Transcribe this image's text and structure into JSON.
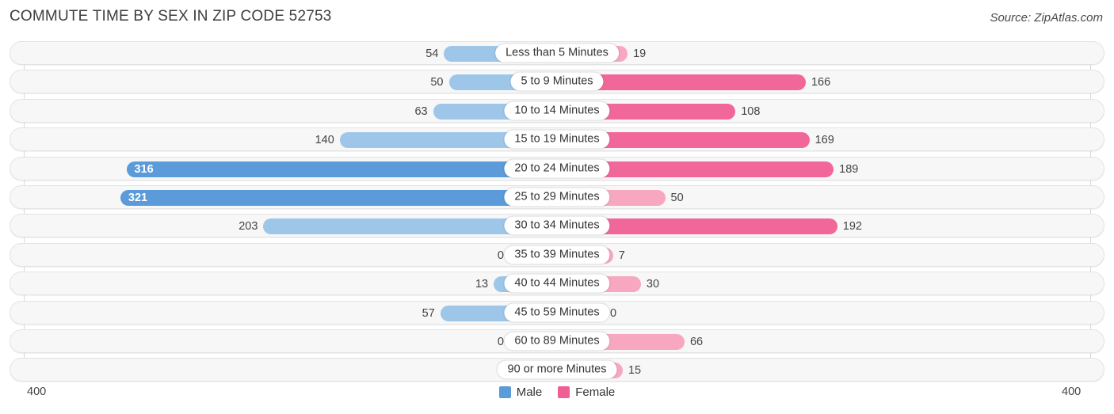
{
  "header": {
    "title": "COMMUTE TIME BY SEX IN ZIP CODE 52753",
    "source": "Source: ZipAtlas.com"
  },
  "axis": {
    "left_label": "400",
    "right_label": "400",
    "max": 400
  },
  "legend": {
    "male_label": "Male",
    "female_label": "Female",
    "male_color": "#5b9bd9",
    "female_color": "#ef5f93"
  },
  "colors": {
    "male_light": "#9ec6e8",
    "male_strong": "#5b9bd9",
    "female_light": "#f7a8c0",
    "female_strong": "#f2679a",
    "track_bg": "#f7f7f7",
    "track_border": "#e3e3e3",
    "gridline": "#d8d8d8"
  },
  "chart_data": {
    "type": "bar",
    "orientation": "horizontal-diverging",
    "title": "COMMUTE TIME BY SEX IN ZIP CODE 52753",
    "xlabel": "",
    "ylabel": "",
    "xlim": [
      -400,
      400
    ],
    "grid": true,
    "legend_position": "bottom-center",
    "categories": [
      "Less than 5 Minutes",
      "5 to 9 Minutes",
      "10 to 14 Minutes",
      "15 to 19 Minutes",
      "20 to 24 Minutes",
      "25 to 29 Minutes",
      "30 to 34 Minutes",
      "35 to 39 Minutes",
      "40 to 44 Minutes",
      "45 to 59 Minutes",
      "60 to 89 Minutes",
      "90 or more Minutes"
    ],
    "series": [
      {
        "name": "Male",
        "direction": "left",
        "values": [
          54,
          50,
          63,
          140,
          316,
          321,
          203,
          0,
          13,
          57,
          0,
          0
        ]
      },
      {
        "name": "Female",
        "direction": "right",
        "values": [
          19,
          166,
          108,
          169,
          189,
          50,
          192,
          7,
          30,
          0,
          66,
          15
        ]
      }
    ]
  }
}
